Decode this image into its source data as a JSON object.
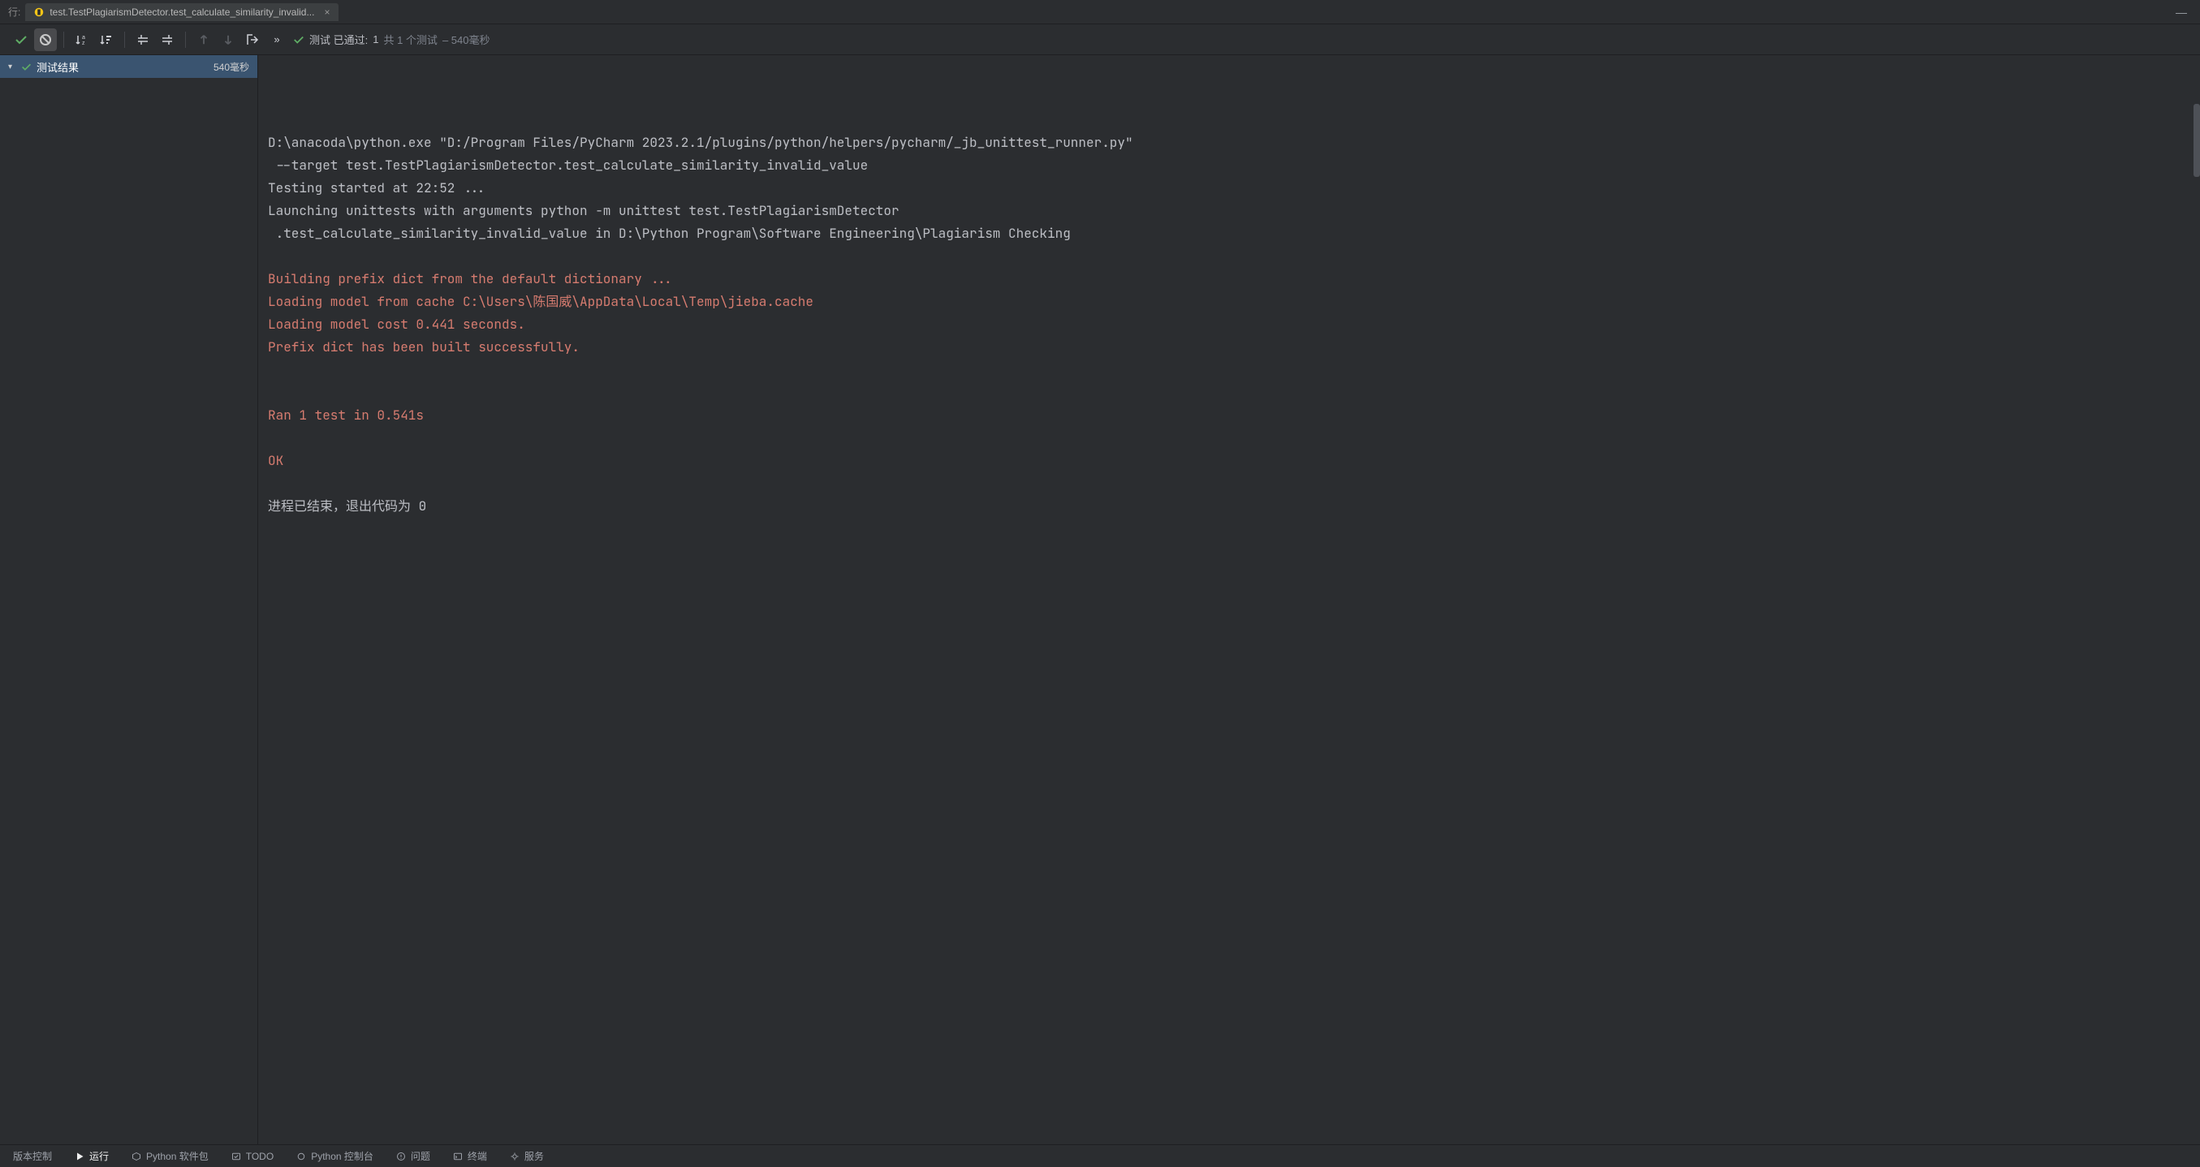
{
  "tab": {
    "prefix": "行:",
    "title": "test.TestPlagiarismDetector.test_calculate_similarity_invalid...",
    "close_glyph": "×"
  },
  "toolbar": {
    "status_prefix": "测试 已通过:",
    "status_pass_count": "1",
    "status_mid": "共 1 个测试",
    "status_time": " – 540毫秒"
  },
  "tree": {
    "root_label": "测试结果",
    "root_time": "540毫秒"
  },
  "console": {
    "lines": [
      {
        "cls": "",
        "text": "D:\\anacoda\\python.exe \"D:/Program Files/PyCharm 2023.2.1/plugins/python/helpers/pycharm/_jb_unittest_runner.py\""
      },
      {
        "cls": "",
        "text": " --target test.TestPlagiarismDetector.test_calculate_similarity_invalid_value"
      },
      {
        "cls": "",
        "text": "Testing started at 22:52 ..."
      },
      {
        "cls": "",
        "text": "Launching unittests with arguments python -m unittest test.TestPlagiarismDetector"
      },
      {
        "cls": "",
        "text": " .test_calculate_similarity_invalid_value in D:\\Python Program\\Software Engineering\\Plagiarism Checking"
      },
      {
        "cls": "",
        "text": ""
      },
      {
        "cls": "stderr",
        "text": "Building prefix dict from the default dictionary ..."
      },
      {
        "cls": "stderr",
        "text": "Loading model from cache C:\\Users\\陈国威\\AppData\\Local\\Temp\\jieba.cache"
      },
      {
        "cls": "stderr",
        "text": "Loading model cost 0.441 seconds."
      },
      {
        "cls": "stderr",
        "text": "Prefix dict has been built successfully."
      },
      {
        "cls": "stderr",
        "text": ""
      },
      {
        "cls": "stderr",
        "text": ""
      },
      {
        "cls": "stderr",
        "text": "Ran 1 test in 0.541s"
      },
      {
        "cls": "stderr",
        "text": ""
      },
      {
        "cls": "stderr",
        "text": "OK"
      },
      {
        "cls": "",
        "text": ""
      },
      {
        "cls": "",
        "text": "进程已结束，退出代码为 0"
      }
    ]
  },
  "bottom": {
    "vcs": "版本控制",
    "run": "运行",
    "pkg": "Python 软件包",
    "todo": "TODO",
    "pyconsole": "Python 控制台",
    "problems": "问题",
    "terminal": "终端",
    "services": "服务"
  }
}
